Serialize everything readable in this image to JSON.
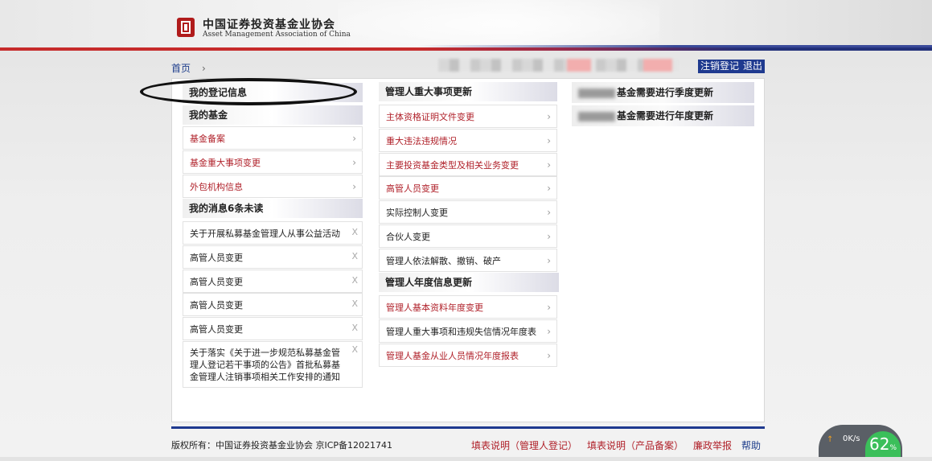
{
  "header": {
    "org_name_cn": "中国证券投资基金业协会",
    "org_name_en": "Asset Management Association of China"
  },
  "breadcrumb": {
    "home": "首页",
    "separator": "›"
  },
  "user_actions": {
    "logout_reg_label": "注销登记",
    "exit_label": "退出"
  },
  "left_column": {
    "registration_info_title": "我的登记信息",
    "my_funds_title": "我的基金",
    "fund_items": [
      "基金备案",
      "基金重大事项变更",
      "外包机构信息"
    ],
    "messages_title": "我的消息6条未读",
    "messages": [
      "关于开展私募基金管理人从事公益活动",
      "高管人员变更",
      "高管人员变更",
      "高管人员变更",
      "高管人员变更",
      "关于落实《关于进一步规范私募基金管理人登记若干事项的公告》首批私募基金管理人注销事项相关工作安排的通知"
    ],
    "close_symbol": "X"
  },
  "middle_column": {
    "major_changes_title": "管理人重大事项更新",
    "major_changes": [
      {
        "label": "主体资格证明文件变更",
        "color": "red"
      },
      {
        "label": "重大违法违规情况",
        "color": "red"
      },
      {
        "label": "主要投资基金类型及相关业务变更",
        "color": "red"
      },
      {
        "label": "高管人员变更",
        "color": "red"
      },
      {
        "label": "实际控制人变更",
        "color": "dark"
      },
      {
        "label": "合伙人变更",
        "color": "dark"
      },
      {
        "label": "管理人依法解散、撤销、破产",
        "color": "dark"
      }
    ],
    "annual_update_title": "管理人年度信息更新",
    "annual_updates": [
      {
        "label": "管理人基本资料年度变更",
        "color": "red"
      },
      {
        "label": "管理人重大事项和违规失信情况年度表",
        "color": "dark"
      },
      {
        "label": "管理人基金从业人员情况年度报表",
        "color": "red"
      }
    ]
  },
  "right_column": {
    "quarterly_notice": "基金需要进行季度更新",
    "annual_notice": "基金需要进行年度更新"
  },
  "footer": {
    "copyright": "版权所有：中国证券投资基金业协会 京ICP备12021741",
    "link_manager_guide": "填表说明（管理人登记）",
    "link_product_guide": "填表说明（产品备案）",
    "link_integrity": "廉政举报",
    "link_help": "帮助"
  },
  "speed_widget": {
    "speed_text": "0K/s",
    "percent": "62",
    "percent_unit": "%"
  },
  "colors": {
    "brand_red": "#b0212a",
    "brand_blue": "#1f3a8f"
  }
}
